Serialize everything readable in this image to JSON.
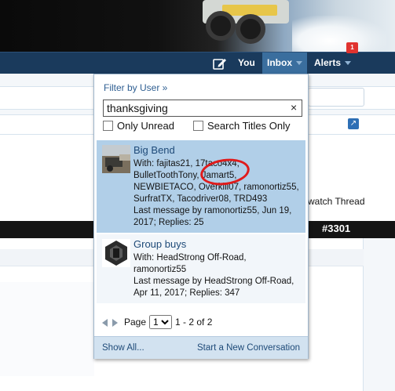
{
  "navbar": {
    "you_label": "You",
    "inbox_label": "Inbox",
    "alerts_label": "Alerts",
    "alerts_badge": "1"
  },
  "page": {
    "watch_thread": "watch Thread",
    "post_number": "#3301"
  },
  "inbox_popup": {
    "filter_label": "Filter by User »",
    "search_value": "thanksgiving",
    "clear_icon": "×",
    "only_unread": "Only Unread",
    "search_titles_only": "Search Titles Only",
    "conversations": [
      {
        "title": "Big Bend",
        "lines": [
          "With: fajitas21, 17taco4x4,",
          "BulletToothTony, Jamart5,",
          "NEWBIETACO, Overkill07, ramonortiz55,",
          "SurfratTX, Tacodriver08, TRD493",
          "Last message by ramonortiz55, Jun 19,",
          "2017; Replies: 25"
        ],
        "selected": true
      },
      {
        "title": "Group buys",
        "lines": [
          "With: HeadStrong Off-Road,",
          "ramonortiz55",
          "Last message by HeadStrong Off-Road,",
          "Apr 11, 2017; Replies: 347"
        ],
        "selected": false
      }
    ],
    "pager": {
      "page_label": "Page",
      "current_page": "1",
      "range_text": "1 - 2 of 2"
    },
    "footer": {
      "show_all": "Show All...",
      "new_conversation": "Start a New Conversation"
    }
  },
  "colors": {
    "navbar": "#1a3a5c",
    "inbox_active": "#3a6e9e",
    "selected_row": "#b1cfe8",
    "link": "#1e4a78",
    "highlight_circle": "#e01b1b"
  }
}
